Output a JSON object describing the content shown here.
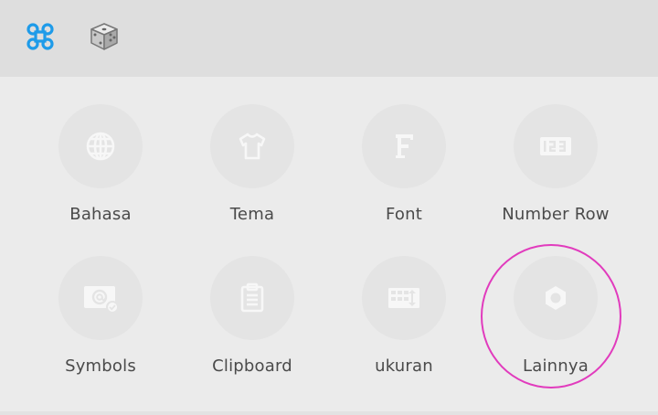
{
  "toolbar": {
    "icons": [
      "command-icon",
      "dice-icon"
    ]
  },
  "tiles": [
    {
      "label": "Bahasa",
      "icon": "globe-icon"
    },
    {
      "label": "Tema",
      "icon": "tshirt-icon"
    },
    {
      "label": "Font",
      "icon": "font-f-icon"
    },
    {
      "label": "Number Row",
      "icon": "number-row-icon"
    },
    {
      "label": "Symbols",
      "icon": "at-symbol-icon"
    },
    {
      "label": "Clipboard",
      "icon": "clipboard-icon"
    },
    {
      "label": "ukuran",
      "icon": "resize-icon"
    },
    {
      "label": "Lainnya",
      "icon": "gear-icon"
    }
  ],
  "colors": {
    "accent": "#1e9be9",
    "highlight": "#e13bbd",
    "icon": "#f7f7f7",
    "label": "#4a4a4a"
  }
}
